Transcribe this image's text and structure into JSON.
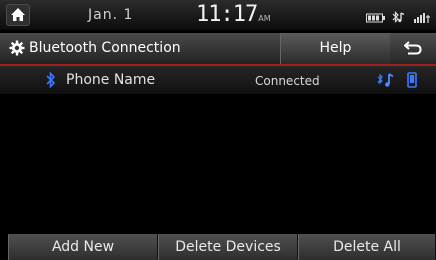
{
  "status": {
    "date": "Jan.  1",
    "time": "11:17",
    "ampm": "AM"
  },
  "title": {
    "text": "Bluetooth Connection",
    "help_label": "Help"
  },
  "device": {
    "name": "Phone Name",
    "status": "Connected"
  },
  "buttons": {
    "add_new": "Add New",
    "delete_devices": "Delete Devices",
    "delete_all": "Delete All"
  },
  "colors": {
    "accent_red": "#a02020",
    "bt_blue": "#3c78ff"
  }
}
